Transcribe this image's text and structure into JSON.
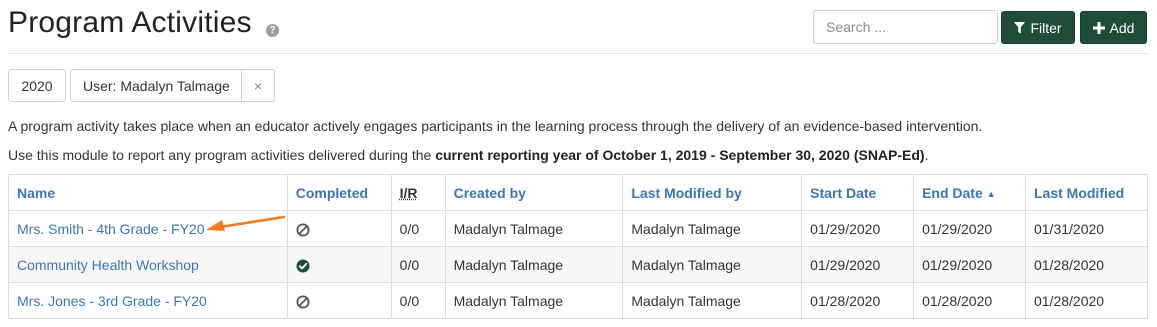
{
  "header": {
    "title": "Program Activities",
    "help_icon": "question-circle-icon",
    "search_placeholder": "Search ...",
    "filter_label": "Filter",
    "add_label": "Add",
    "filter_icon": "funnel-icon",
    "add_icon": "plus-icon"
  },
  "filters": {
    "year": "2020",
    "user": "User: Madalyn Talmage",
    "remove": "×"
  },
  "description": {
    "line1": "A program activity takes place when an educator actively engages participants in the learning process through the delivery of an evidence-based intervention.",
    "line2_prefix": "Use this module to report any program activities delivered during the ",
    "line2_bold": "current reporting year of October 1, 2019 - September 30, 2020 (SNAP-Ed)",
    "line2_suffix": "."
  },
  "table": {
    "columns": {
      "name": "Name",
      "completed": "Completed",
      "ir": "I/R",
      "created_by": "Created by",
      "last_modified_by": "Last Modified by",
      "start_date": "Start Date",
      "end_date": "End Date",
      "last_modified": "Last Modified"
    },
    "sort": {
      "column": "end_date",
      "direction": "ascending",
      "indicator": "▲"
    },
    "rows": [
      {
        "name": "Mrs. Smith - 4th Grade - FY20",
        "completed": false,
        "completed_icon": "ban-icon",
        "ir": "0/0",
        "created_by": "Madalyn Talmage",
        "last_modified_by": "Madalyn Talmage",
        "start_date": "01/29/2020",
        "end_date": "01/29/2020",
        "last_modified": "01/31/2020"
      },
      {
        "name": "Community Health Workshop",
        "completed": true,
        "completed_icon": "check-circle-icon",
        "ir": "0/0",
        "created_by": "Madalyn Talmage",
        "last_modified_by": "Madalyn Talmage",
        "start_date": "01/29/2020",
        "end_date": "01/29/2020",
        "last_modified": "01/28/2020"
      },
      {
        "name": "Mrs. Jones - 3rd Grade - FY20",
        "completed": false,
        "completed_icon": "ban-icon",
        "ir": "0/0",
        "created_by": "Madalyn Talmage",
        "last_modified_by": "Madalyn Talmage",
        "start_date": "01/28/2020",
        "end_date": "01/28/2020",
        "last_modified": "01/28/2020"
      }
    ]
  },
  "annotation": {
    "arrow_icon": "arrow-left-icon",
    "arrow_color": "#f07c1e"
  },
  "colors": {
    "primary_button": "#1f4d3a",
    "link": "#3b75b0",
    "completed": "#1f4d3a",
    "not_completed": "#555555"
  }
}
